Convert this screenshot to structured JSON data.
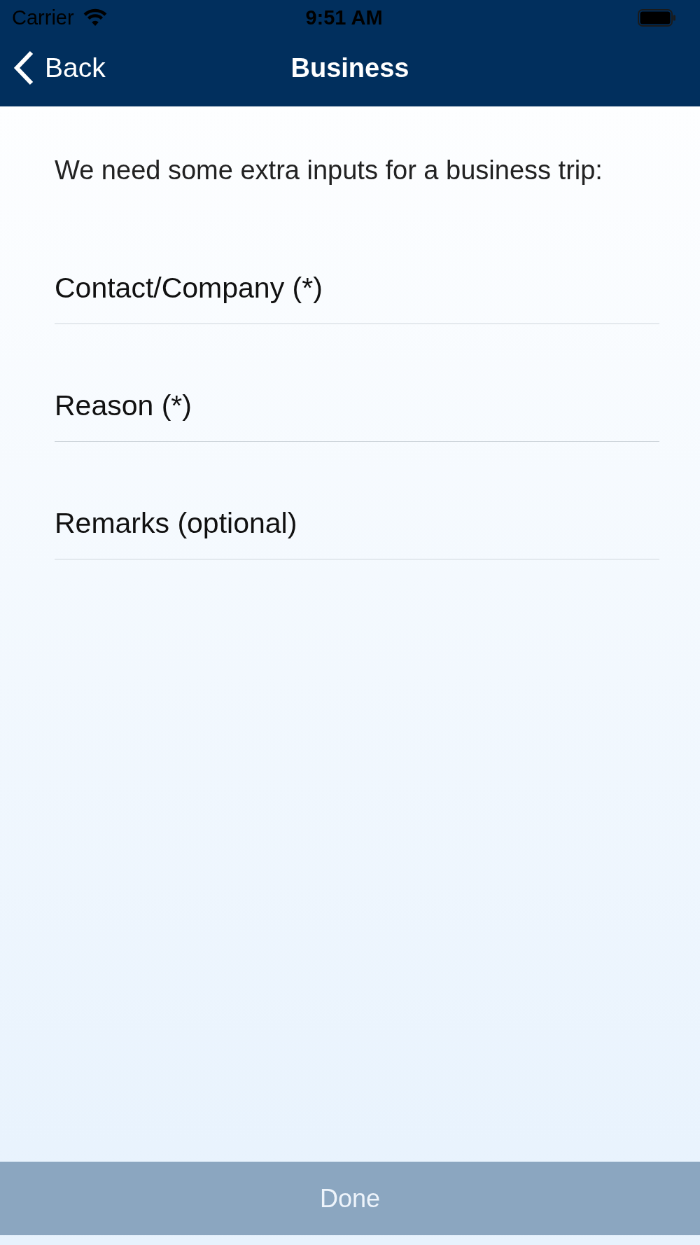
{
  "status_bar": {
    "carrier": "Carrier",
    "time": "9:51 AM"
  },
  "nav_bar": {
    "back": "Back",
    "title": "Business"
  },
  "intro": "We need some extra inputs for a business trip:",
  "fields": [
    {
      "placeholder": "Contact/Company (*)"
    },
    {
      "placeholder": "Reason (*)"
    },
    {
      "placeholder": "Remarks (optional)"
    }
  ],
  "done_button": {
    "label": "Done",
    "disabled": true
  }
}
